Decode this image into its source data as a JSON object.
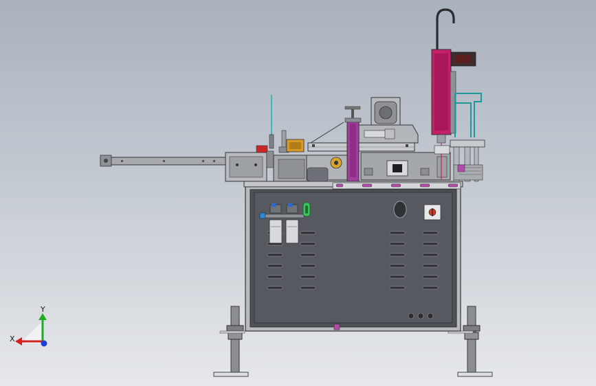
{
  "view": {
    "background_top": "#a9b1bd",
    "background_bottom": "#e6e8eb"
  },
  "triad": {
    "x_label": "X",
    "y_label": "Y",
    "x_color": "#d62020",
    "y_color": "#22aa22",
    "z_color": "#1f3fd8"
  },
  "palette": {
    "frame": "#9a9da3",
    "frame_dark": "#5f6368",
    "cabinet_panel": "#55595e",
    "cabinet_inner": "#4a4e53",
    "accent_magenta": "#c51f6a",
    "accent_purple": "#a23e9c",
    "accent_teal": "#1fb5b5",
    "accent_green": "#3ec45a",
    "accent_orange": "#d59a2a",
    "accent_red": "#c82828"
  }
}
